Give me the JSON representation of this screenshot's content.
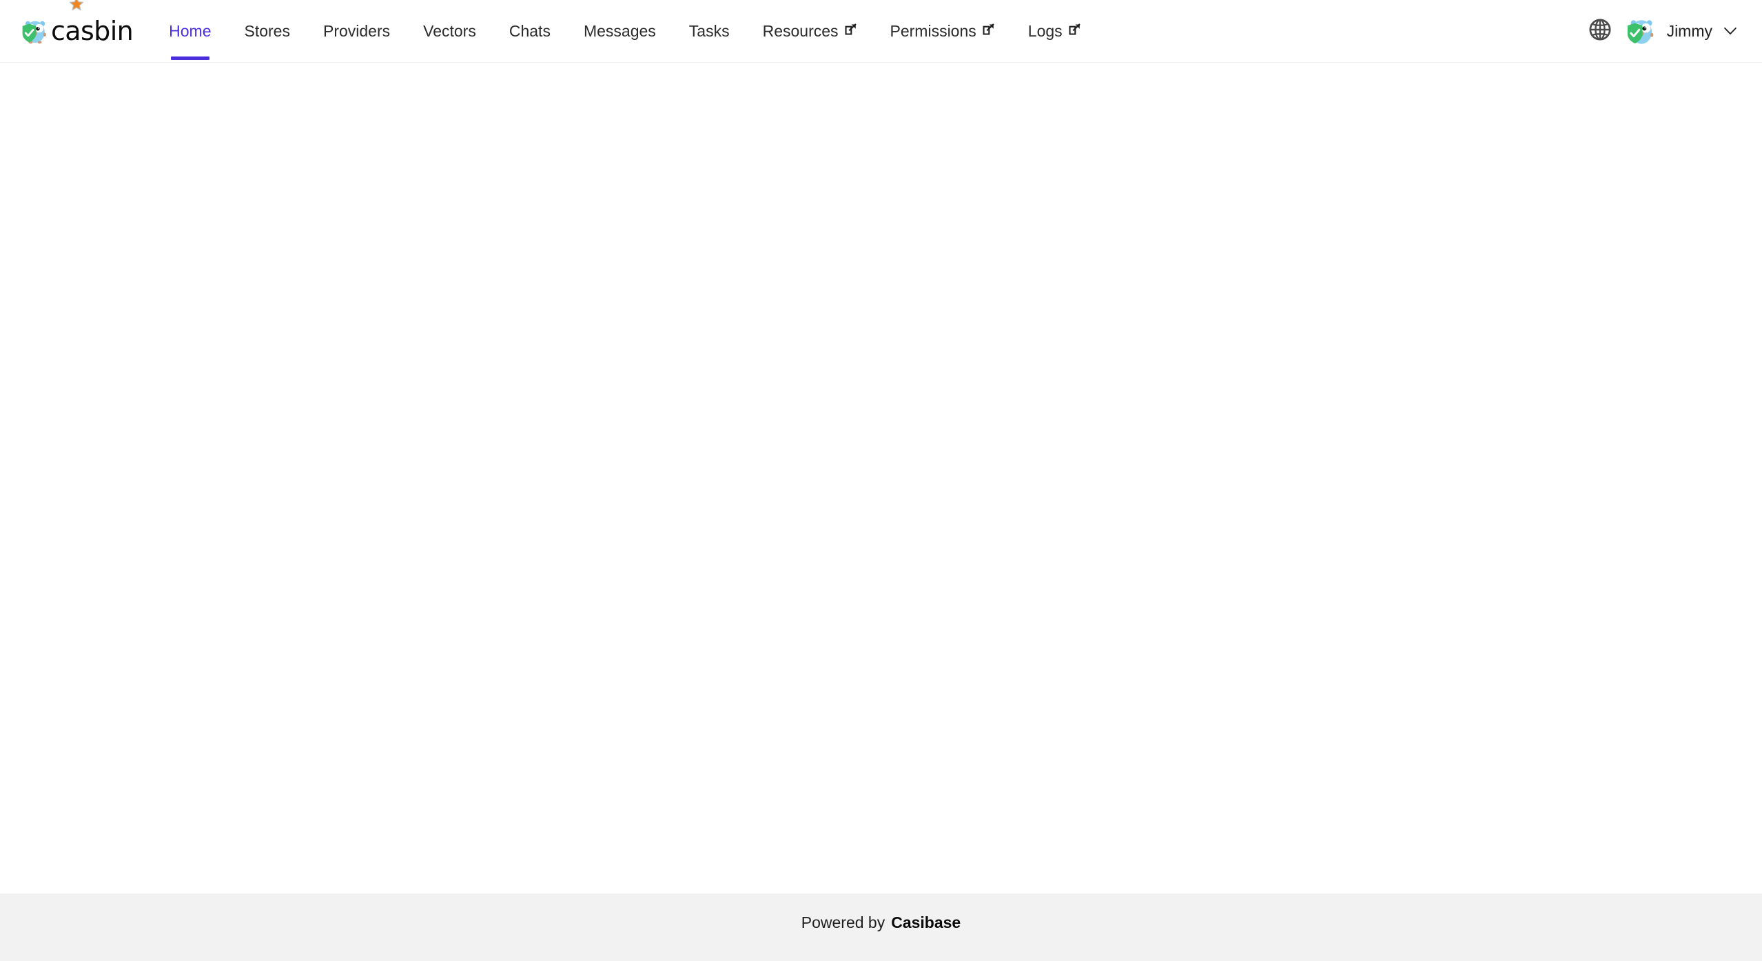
{
  "brand": {
    "name": "casbin",
    "logo_icon": "casbin-gopher-shield-logo",
    "star_icon": "star-icon",
    "star_color": "#f2861e"
  },
  "nav": {
    "active": "Home",
    "accent_color": "#4b2ee0",
    "items": [
      {
        "label": "Home",
        "external": false,
        "active": true,
        "icon": ""
      },
      {
        "label": "Stores",
        "external": false,
        "active": false,
        "icon": ""
      },
      {
        "label": "Providers",
        "external": false,
        "active": false,
        "icon": ""
      },
      {
        "label": "Vectors",
        "external": false,
        "active": false,
        "icon": ""
      },
      {
        "label": "Chats",
        "external": false,
        "active": false,
        "icon": ""
      },
      {
        "label": "Messages",
        "external": false,
        "active": false,
        "icon": ""
      },
      {
        "label": "Tasks",
        "external": false,
        "active": false,
        "icon": ""
      },
      {
        "label": "Resources",
        "external": true,
        "active": false,
        "icon": "external-link-icon"
      },
      {
        "label": "Permissions",
        "external": true,
        "active": false,
        "icon": "external-link-icon"
      },
      {
        "label": "Logs",
        "external": true,
        "active": false,
        "icon": "external-link-icon"
      }
    ]
  },
  "header_right": {
    "language_icon": "globe-icon",
    "avatar_icon": "casbin-gopher-shield-avatar",
    "account_name": "Jimmy",
    "caret_icon": "chevron-down-icon"
  },
  "main": {
    "content": ""
  },
  "footer": {
    "powered_by_label": "Powered by",
    "brand_label": "Casibase",
    "background_color": "#f2f2f2"
  }
}
